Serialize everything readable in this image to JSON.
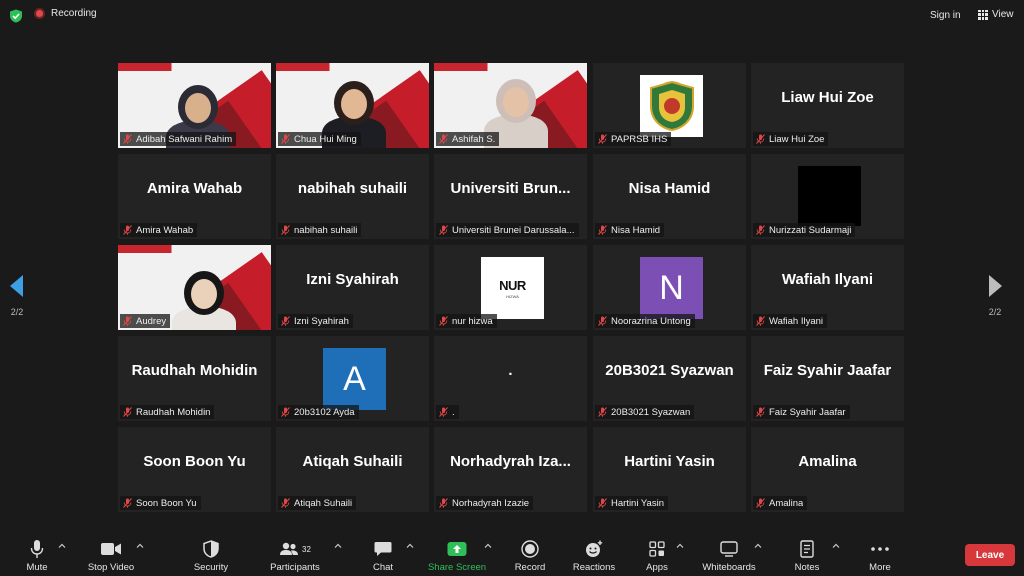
{
  "topbar": {
    "recording_label": "Recording",
    "signin_label": "Sign in",
    "view_label": "View"
  },
  "nav": {
    "page_left": "2/2",
    "page_right": "2/2"
  },
  "participants": [
    {
      "label": "Adibah Safwani Rahim",
      "type": "video",
      "muted": true
    },
    {
      "label": "Chua Hui Ming",
      "type": "video",
      "muted": true
    },
    {
      "label": "Ashifah S.",
      "type": "video",
      "muted": true
    },
    {
      "label": "PAPRSB IHS",
      "type": "logo",
      "muted": true
    },
    {
      "label": "Liaw Hui Zoe",
      "type": "name",
      "display": "Liaw Hui Zoe",
      "muted": true
    },
    {
      "label": "Amira Wahab",
      "type": "name",
      "display": "Amira Wahab",
      "muted": true
    },
    {
      "label": "nabihah suhaili",
      "type": "name",
      "display": "nabihah suhaili",
      "muted": true
    },
    {
      "label": "Universiti Brunei Darussala...",
      "type": "name",
      "display": "Universiti  Brun...",
      "muted": true
    },
    {
      "label": "Nisa Hamid",
      "type": "name",
      "display": "Nisa Hamid",
      "muted": true
    },
    {
      "label": "Nurizzati Sudarmaji",
      "type": "black",
      "muted": true
    },
    {
      "label": "Audrey",
      "type": "video",
      "muted": true
    },
    {
      "label": "Izni Syahirah",
      "type": "name",
      "display": "Izni Syahirah",
      "muted": true
    },
    {
      "label": "nur hizwa",
      "type": "nur",
      "muted": true
    },
    {
      "label": "Noorazrina Untong",
      "type": "letter",
      "letter": "N",
      "color": "#7c4fb5",
      "muted": true
    },
    {
      "label": "Wafiah Ilyani",
      "type": "name",
      "display": "Wafiah Ilyani",
      "muted": true
    },
    {
      "label": "Raudhah Mohidin",
      "type": "name",
      "display": "Raudhah Mohidin",
      "muted": true
    },
    {
      "label": "20b3102 Ayda",
      "type": "letter",
      "letter": "A",
      "color": "#1f6fb8",
      "muted": true
    },
    {
      "label": ".",
      "type": "name",
      "display": ".",
      "muted": true
    },
    {
      "label": "20B3021 Syazwan",
      "type": "name",
      "display": "20B3021 Syazwan",
      "muted": true
    },
    {
      "label": "Faiz Syahir Jaafar",
      "type": "name",
      "display": "Faiz Syahir Jaafar",
      "muted": true
    },
    {
      "label": "Soon Boon Yu",
      "type": "name",
      "display": "Soon Boon Yu",
      "muted": true
    },
    {
      "label": "Atiqah Suhaili",
      "type": "name",
      "display": "Atiqah Suhaili",
      "muted": true
    },
    {
      "label": "Norhadyrah Izazie",
      "type": "name",
      "display": "Norhadyrah  Iza...",
      "muted": true
    },
    {
      "label": "Hartini Yasin",
      "type": "name",
      "display": "Hartini Yasin",
      "muted": true
    },
    {
      "label": "Amalina",
      "type": "name",
      "display": "Amalina",
      "muted": true
    }
  ],
  "toolbar": {
    "mute": "Mute",
    "stop_video": "Stop Video",
    "security": "Security",
    "participants": "Participants",
    "participants_count": "32",
    "chat": "Chat",
    "share_screen": "Share Screen",
    "record": "Record",
    "reactions": "Reactions",
    "apps": "Apps",
    "whiteboards": "Whiteboards",
    "notes": "Notes",
    "more": "More",
    "leave": "Leave"
  },
  "colors": {
    "share_screen": "#2fbf58",
    "leave": "#d6383c",
    "muted_mic": "#e04848"
  }
}
